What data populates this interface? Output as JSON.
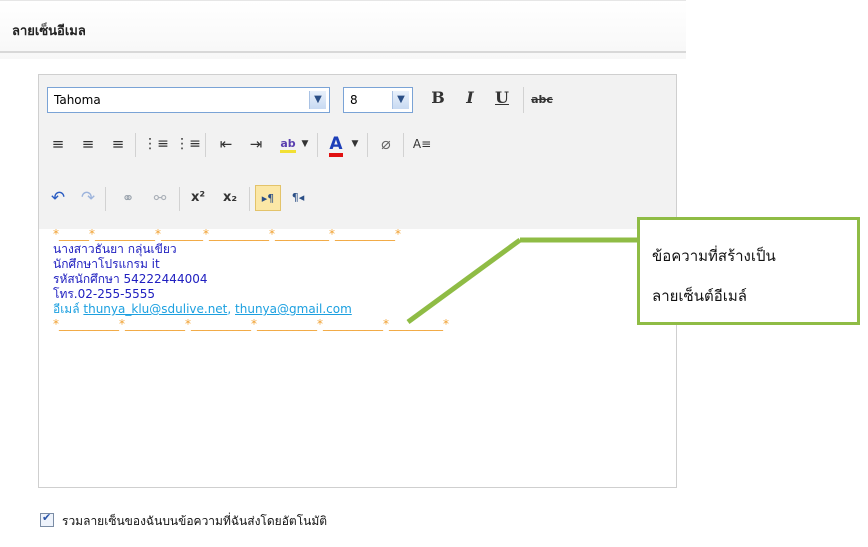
{
  "section": {
    "title": "ลายเซ็นอีเมล"
  },
  "toolbar": {
    "font_name": "Tahoma",
    "font_size": "8",
    "bold": "B",
    "italic": "I",
    "underline": "U",
    "strike": "abc",
    "superscript": "x²",
    "subscript": "x₂",
    "ltr": "▸¶",
    "rtl": "¶◂",
    "text_color_letter": "A"
  },
  "signature": {
    "stars_top": "*_____*__________*_______*__________*_________*__________*",
    "name": "นางสาวธันยา  กลุ่นเขียว",
    "role": "นักศึกษาโปรแกรม it",
    "student_id": "รหัสนักศึกษา 54222444004",
    "phone": "โทร.02-255-5555",
    "email_prefix": "อีเมล์ ",
    "email1": "thunya_klu@sdulive.net",
    "email_sep": ", ",
    "email2": "thunya@gmail.com",
    "stars_bottom": "*__________*__________*__________*__________*__________*_________*"
  },
  "callout": {
    "line1": "ข้อความที่สร้างเป็น",
    "line2": "ลายเซ็นต์อีเมล์"
  },
  "options": {
    "auto_include_label": "รวมลายเซ็นของฉันบนข้อความที่ฉันส่งโดยอัตโนมัติ",
    "auto_include_checked": true
  },
  "colors": {
    "callout_border": "#8fbc45",
    "signature_text": "#2020c0",
    "email_text": "#1ca0e0",
    "stars": "#f0a030"
  }
}
